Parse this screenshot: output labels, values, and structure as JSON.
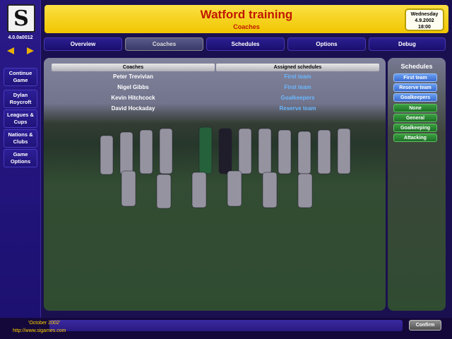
{
  "app": {
    "version": "4.0.0a0012",
    "logo_letter": "S"
  },
  "header": {
    "title": "Watford training",
    "subtitle": "Coaches",
    "date": {
      "weekday": "Wednesday",
      "date": "4.9.2002",
      "time": "18:00"
    }
  },
  "sidebar": {
    "items": [
      {
        "label": "Continue Game"
      },
      {
        "label": "Dylan Roycroft"
      },
      {
        "label": "Leagues & Cups"
      },
      {
        "label": "Nations & Clubs"
      },
      {
        "label": "Game Options"
      }
    ]
  },
  "tabs": [
    {
      "label": "Overview"
    },
    {
      "label": "Coaches",
      "active": true
    },
    {
      "label": "Schedules"
    },
    {
      "label": "Options"
    },
    {
      "label": "Debug"
    }
  ],
  "table": {
    "columns": [
      "Coaches",
      "Assigned schedules"
    ],
    "rows": [
      {
        "coach": "Peter Trevivian",
        "schedule": "First team"
      },
      {
        "coach": "Nigel Gibbs",
        "schedule": "First team"
      },
      {
        "coach": "Kevin Hitchcock",
        "schedule": "Goalkeepers"
      },
      {
        "coach": "David Hockaday",
        "schedule": "Reserve team"
      }
    ]
  },
  "schedules": {
    "heading": "Schedules",
    "items": [
      {
        "label": "First team",
        "color": "blue"
      },
      {
        "label": "Reserve team",
        "color": "blue"
      },
      {
        "label": "Goalkeepers",
        "color": "blue"
      },
      {
        "label": "None",
        "color": "green"
      },
      {
        "label": "General",
        "color": "green"
      },
      {
        "label": "Goalkeeping",
        "color": "green"
      },
      {
        "label": "Attacking",
        "color": "green"
      }
    ]
  },
  "footer": {
    "date_text": "'October 2002'",
    "url": "http://www.sigames.com",
    "confirm_label": "Confirm"
  },
  "colors": {
    "header_bg": "#f5d000",
    "title_red": "#c01800",
    "schedule_text": "#6ab8ff",
    "accent_yellow": "#e8b000"
  }
}
